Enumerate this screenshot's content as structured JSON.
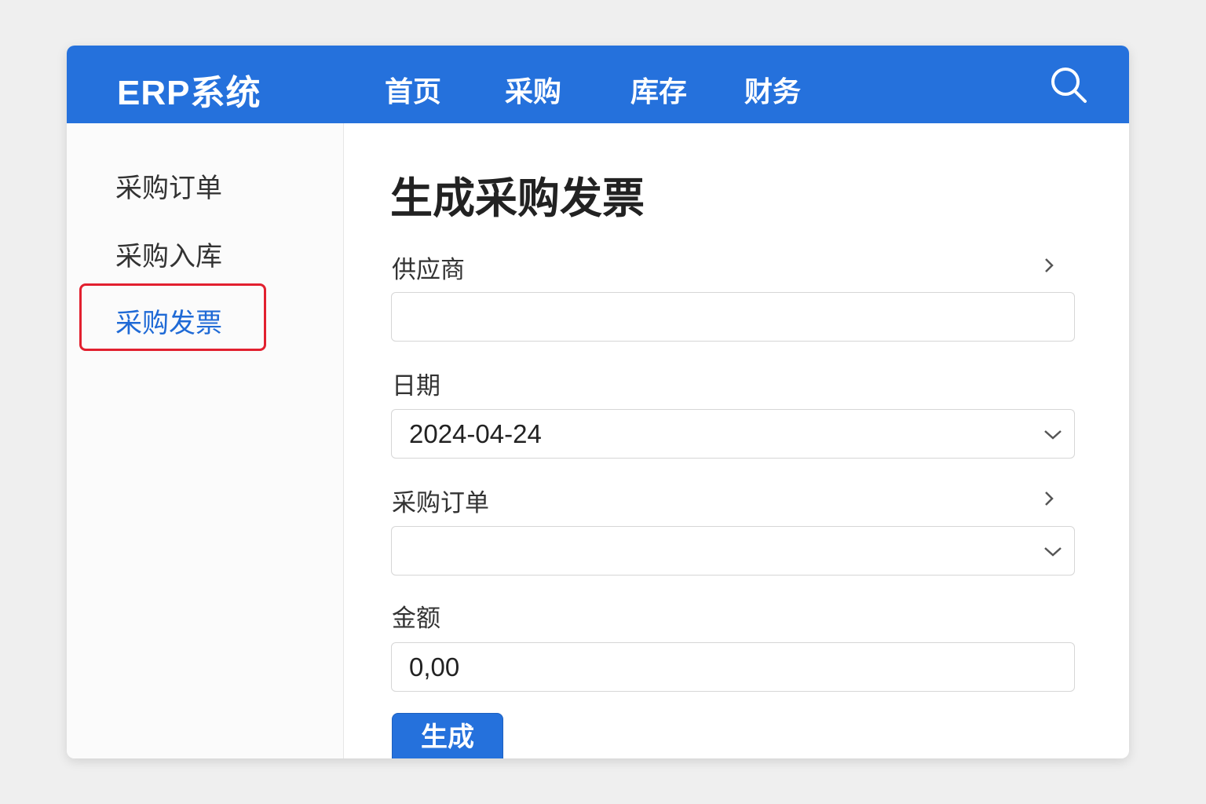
{
  "header": {
    "logo": "ERP系统",
    "nav": [
      "首页",
      "采购",
      "库存",
      "财务"
    ]
  },
  "sidebar": {
    "items": [
      {
        "label": "采购订单"
      },
      {
        "label": "采购入库"
      },
      {
        "label": "采购发票",
        "active": true
      }
    ]
  },
  "main": {
    "title": "生成采购发票",
    "supplier": {
      "label": "供应商",
      "value": ""
    },
    "date": {
      "label": "日期",
      "value": "2024-04-24"
    },
    "order": {
      "label": "采购订单",
      "value": ""
    },
    "amount": {
      "label": "金额",
      "value": "0,00"
    },
    "submit_label": "生成"
  },
  "colors": {
    "brand": "#2571dc",
    "highlight": "#e2202f",
    "active": "#1f6ad6"
  }
}
